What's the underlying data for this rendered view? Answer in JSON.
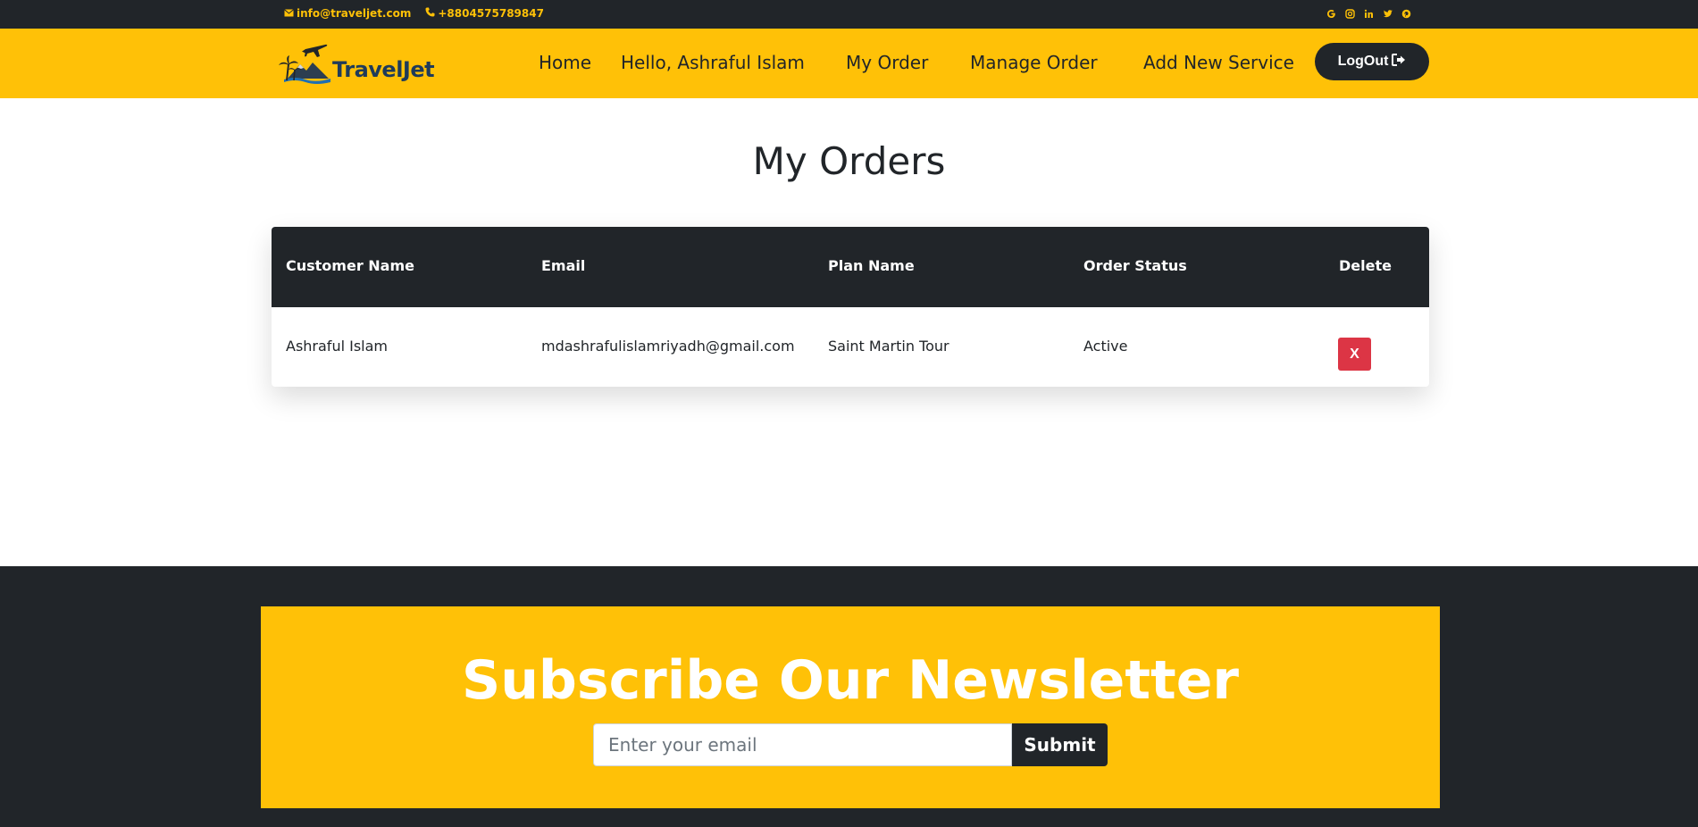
{
  "topbar": {
    "email": "info@traveljet.com",
    "phone": "+8804575789847",
    "social_icons": [
      "google-icon",
      "instagram-icon",
      "linkedin-icon",
      "twitter-icon",
      "pinterest-icon"
    ]
  },
  "navbar": {
    "logo_text": "TravelJet",
    "links": [
      "Home",
      "Hello, Ashraful Islam",
      "My Order",
      "Manage Order",
      "Add New Service"
    ],
    "logout_label": "LogOut",
    "logout_icon": "sign-out-icon"
  },
  "page": {
    "title": "My Orders"
  },
  "orders_table": {
    "headers": [
      "Customer Name",
      "Email",
      "Plan Name",
      "Order Status",
      "Delete"
    ],
    "rows": [
      {
        "customer_name": "Ashraful Islam",
        "email": "mdashrafulislamriyadh@gmail.com",
        "plan_name": "Saint Martin Tour",
        "order_status": "Active",
        "delete_label": "X"
      }
    ]
  },
  "newsletter": {
    "title": "Subscribe Our Newsletter",
    "email_placeholder": "Enter your email",
    "submit_label": "Submit"
  },
  "colors": {
    "accent": "#ffc107",
    "dark": "#212529",
    "danger": "#dc3545"
  }
}
